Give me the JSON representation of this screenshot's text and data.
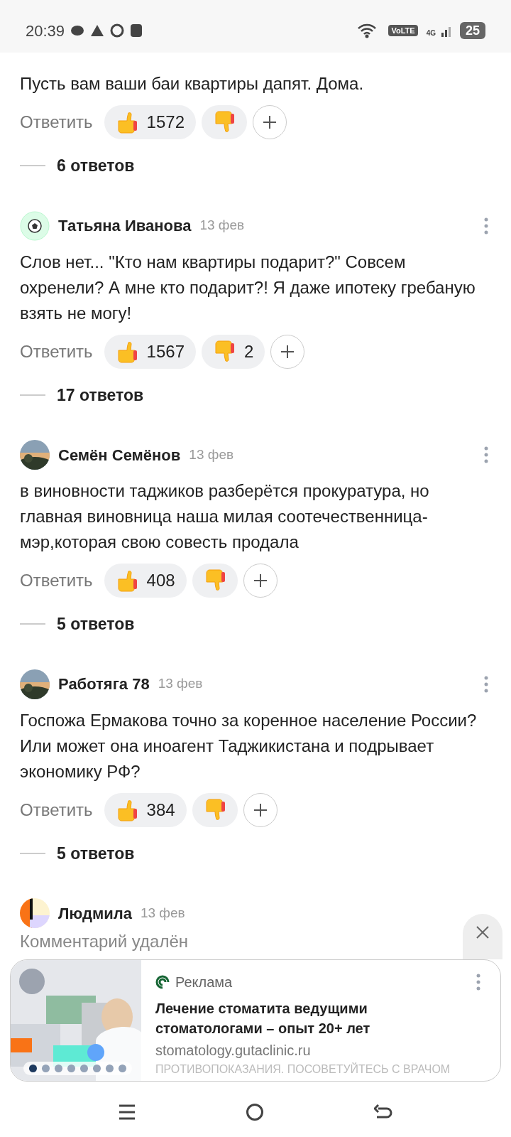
{
  "status_bar": {
    "time": "20:39",
    "network_badge": "VoLTE",
    "network_type": "4G",
    "battery": "25"
  },
  "comments": [
    {
      "kind": "normal",
      "text": "Пусть вам ваши баи квартиры дапят. Дома.",
      "reply": "Ответить",
      "likes": "1572",
      "replies": "6 ответов"
    },
    {
      "kind": "normal",
      "header": {
        "avatar": {
          "kind": "ball"
        },
        "name": "Татьяна Иванова",
        "date": "13 фев"
      },
      "text": "Слов нет... \"Кто нам квартиры подарит?\" Совсем охренели? А мне кто подарит?! Я даже ипотеку гребаную взять не могу!",
      "reply": "Ответить",
      "likes": "1567",
      "dislikes": "2",
      "replies": "17 ответов"
    },
    {
      "kind": "normal",
      "header": {
        "name": "Семён Семёнов",
        "date": "13 фев"
      },
      "text": "в виновности таджиков разберётся прокуратура, но главная виновница наша милая соотечественница-мэр,которая свою совесть продала",
      "reply": "Ответить",
      "likes": "408",
      "replies": "5 ответов"
    },
    {
      "kind": "normal",
      "header": {
        "name": "Работяга 78",
        "date": "13 фев"
      },
      "text": "Госпожа Ермакова точно за коренное население России? Или может она иноагент Таджикистана и подрывает экономику РФ?",
      "reply": "Ответить",
      "likes": "384",
      "replies": "5 ответов"
    },
    {
      "kind": "deleted",
      "header": {
        "avatar": {
          "kind": "blocks"
        },
        "name": "Людмила",
        "date": "13 фев"
      },
      "text": "Комментарий удалён"
    }
  ],
  "ad": {
    "label": "Реклама",
    "title": "Лечение стоматита ведущими стоматологами – опыт 20+ лет",
    "domain": "stomatology.gutaclinic.ru",
    "disclaimer": "ПРОТИВОПОКАЗАНИЯ. ПОСОВЕТУЙТЕСЬ С ВРАЧОМ",
    "slides": [
      {
        "selected": true
      },
      {
        "selected": false
      },
      {
        "selected": false
      },
      {
        "selected": false
      },
      {
        "selected": false
      },
      {
        "selected": false
      },
      {
        "selected": false
      },
      {
        "selected": false
      }
    ]
  }
}
